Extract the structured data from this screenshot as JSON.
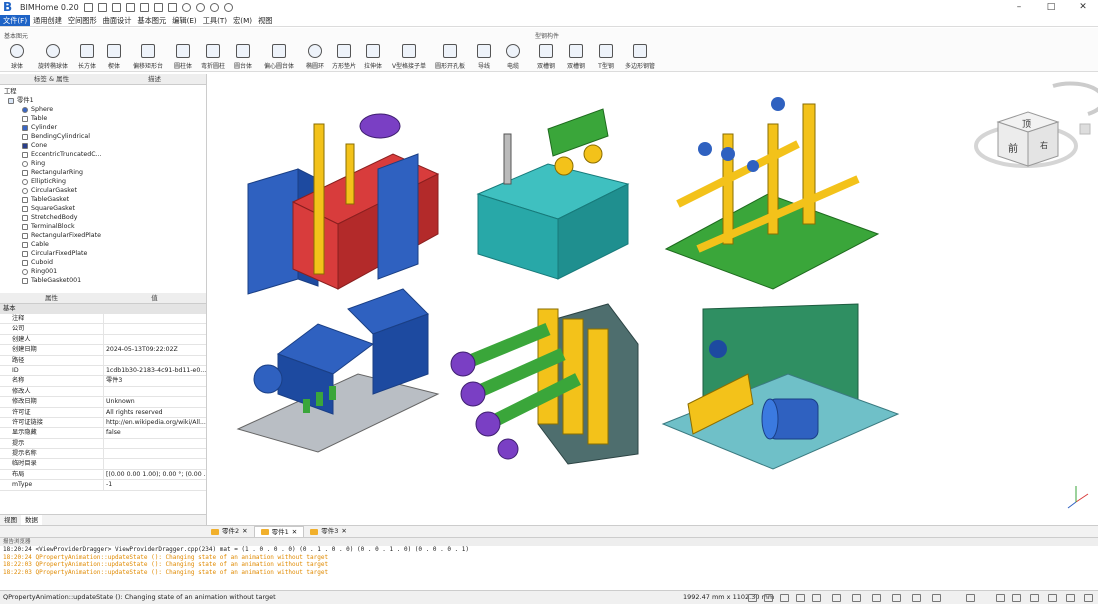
{
  "app": {
    "title": "BIMHome 0.20"
  },
  "menu": [
    "文件(F)",
    "通用创建",
    "空间图形",
    "曲面设计",
    "基本图元",
    "编辑(E)",
    "工具(T)",
    "宏(M)",
    "视图"
  ],
  "ribbon": {
    "group1": "基本图元",
    "group2": "型钢构件",
    "buttons": [
      "球体",
      "旋转椭球体",
      "长方体",
      "楔体",
      "偏移矩形台",
      "圆柱体",
      "弯折圆柱",
      "圆台体",
      "偏心圆台体",
      "椭圆环",
      "方形垫片",
      "拉伸体",
      "V型格接子单",
      "圆形开孔板",
      "导线",
      "电缆",
      "双槽钢",
      "双槽钢",
      "T型钢",
      "多边形钢管"
    ]
  },
  "tree": {
    "tabs": [
      "标签 & 属性",
      "描述"
    ],
    "section": "工程",
    "root": "零件1",
    "items": [
      "Sphere",
      "Table",
      "Cylinder",
      "BendingCylindrical",
      "Cone",
      "EccentricTruncatedC...",
      "Ring",
      "RectangularRing",
      "EllipticRing",
      "CircularGasket",
      "TableGasket",
      "SquareGasket",
      "StretchedBody",
      "TerminalBlock",
      "RectangularFixedPlate",
      "Cable",
      "CircularFixedPlate",
      "Cuboid",
      "Ring001",
      "TableGasket001"
    ]
  },
  "props": {
    "header": [
      "属性",
      "值"
    ],
    "group": "基本",
    "rows": [
      {
        "k": "注释",
        "v": ""
      },
      {
        "k": "公司",
        "v": ""
      },
      {
        "k": "创建人",
        "v": ""
      },
      {
        "k": "创建日期",
        "v": "2024-05-13T09:22:02Z"
      },
      {
        "k": "路径",
        "v": ""
      },
      {
        "k": "ID",
        "v": "1cdb1b30-2183-4c91-bd11-e0..."
      },
      {
        "k": "名称",
        "v": "零件3"
      },
      {
        "k": "修改人",
        "v": ""
      },
      {
        "k": "修改日期",
        "v": "Unknown"
      },
      {
        "k": "许可证",
        "v": "All rights reserved"
      },
      {
        "k": "许可证链接",
        "v": "http://en.wikipedia.org/wiki/All..."
      },
      {
        "k": "显示隐藏",
        "v": "false"
      },
      {
        "k": "提示",
        "v": ""
      },
      {
        "k": "提示名称",
        "v": ""
      },
      {
        "k": "临时目录",
        "v": ""
      },
      {
        "k": "布局",
        "v": "[(0.00 0.00 1.00); 0.00 °; (0.00 ..."
      },
      {
        "k": "mType",
        "v": "-1"
      }
    ]
  },
  "bottomtabs": [
    "视图",
    "数据"
  ],
  "doctabs": [
    "零件2",
    "零件1",
    "零件3"
  ],
  "report": {
    "title": "报告浏览器",
    "lines": [
      "18:20:24  <ViewProviderDragger> ViewProviderDragger.cpp(234)  mat = (1 . 0 . 0 . 0) (0 . 1 . 0 . 0) (0 . 0 . 1 . 0) (0 . 0 . 0 . 1)",
      "18:20:24  QPropertyAnimation::updateState (): Changing state of an animation without target",
      "18:22:03  QPropertyAnimation::updateState (): Changing state of an animation without target",
      "18:22:03  QPropertyAnimation::updateState (): Changing state of an animation without target"
    ]
  },
  "status": {
    "text": "QPropertyAnimation::updateState (): Changing state of an animation without target",
    "dims": "1992.47 mm x 1102.30 mm"
  },
  "navcube": {
    "top": "顶",
    "front": "前",
    "right": "右"
  },
  "colors": {
    "accent": "#1e63c6",
    "blue": "#2f61c0",
    "red": "#d83c3c",
    "yellow": "#f3c21a",
    "green": "#3aa63a",
    "teal": "#28a8a8",
    "purple": "#7a3fc4",
    "gray": "#b9bec4"
  }
}
